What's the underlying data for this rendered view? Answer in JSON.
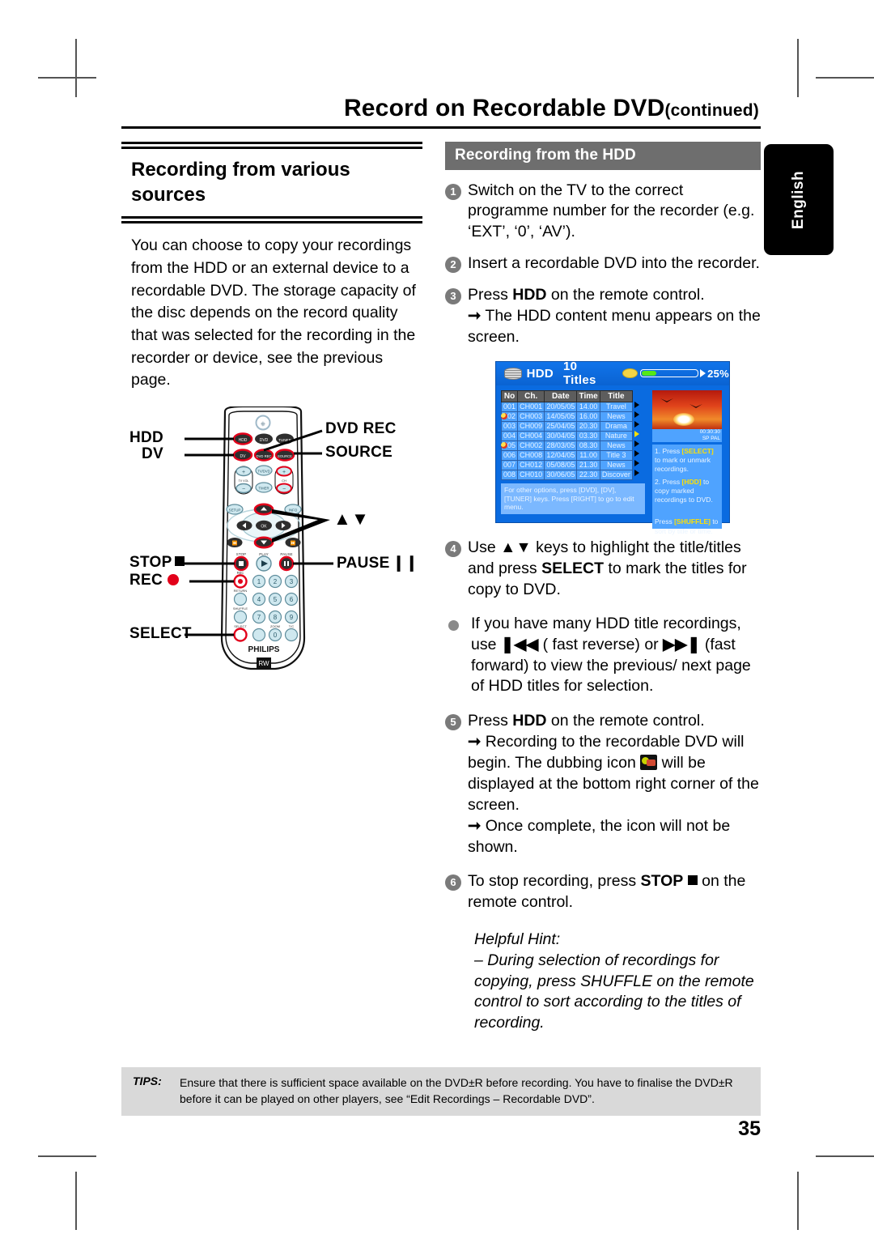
{
  "header": {
    "title": "Record on Recordable DVD",
    "continued": "(continued)"
  },
  "lang_tab": {
    "label": "English"
  },
  "left": {
    "heading": "Recording from various sources",
    "body": "You can choose to copy your recordings from the HDD or an external device to a recordable DVD. The storage capacity of the disc depends on the record quality that was selected for the recording in the recorder or device, see the previous page."
  },
  "remote": {
    "callouts": {
      "hdd": "HDD",
      "dv": "DV",
      "dvd_rec": "DVD REC",
      "source": "SOURCE",
      "updown": "▲▼",
      "stop": "STOP",
      "pause": "PAUSE",
      "rec": "REC",
      "select": "SELECT"
    },
    "brand": "PHILIPS",
    "buttons": {
      "hdd": "HDD",
      "dvd": "DVD",
      "tuner": "TUNER",
      "dv": "DV",
      "dvdrec": "DVD REC",
      "source": "SOURCE",
      "tvvol": "TV VOL",
      "tvdvd": "TV/DVD",
      "timer": "TIMER",
      "ch": "CH",
      "setup": "SETUP",
      "info": "INFO",
      "ok": "OK",
      "stop_lbl": "STOP",
      "play_lbl": "PLAY",
      "pause_lbl": "PAUSE",
      "rec_lbl": "REC",
      "return_lbl": "RETURN",
      "shuffle_lbl": "SHUFFLE",
      "select_lbl": "SELECT",
      "zoom_lbl": "ZOOM",
      "tc_lbl": "T/C",
      "digits": [
        "1",
        "2",
        "3",
        "4",
        "5",
        "6",
        "7",
        "8",
        "9",
        "0"
      ]
    }
  },
  "right": {
    "section_bar": "Recording from the HDD",
    "steps": [
      {
        "num": "1",
        "html": "Switch on the TV to the correct programme number for the recorder (e.g. ‘EXT’, ‘0’, ‘AV’)."
      },
      {
        "num": "2",
        "html": "Insert a recordable DVD into the recorder."
      },
      {
        "num": "3",
        "html": "Press HDD on the remote control."
      },
      {
        "num": "4",
        "html": "Use ▲▼ keys to highlight the title/titles and press SELECT to mark the titles for copy to DVD."
      },
      {
        "num": "5",
        "html": "Press HDD on the remote control."
      },
      {
        "num": "6",
        "html": "To stop recording, press STOP on the remote control."
      }
    ],
    "step3_arrow": "The HDD content menu appears on the screen.",
    "bullet_text": "If you have many HDD title recordings, use",
    "bullet_text2": "( fast reverse) or",
    "bullet_text3": "(fast forward) to view the previous/ next page of HDD titles for selection.",
    "step5_arrow1a": "Recording to the recordable DVD will begin. The dubbing icon",
    "step5_arrow1b": "will be displayed at the bottom right corner of the screen.",
    "step5_arrow2": "Once complete, the icon will not be shown.",
    "helpful_hint_label": "Helpful Hint:",
    "helpful_hint_body": "– During selection of recordings for copying, press SHUFFLE on the remote control to sort according to the titles of recording."
  },
  "tv_screen": {
    "title": "HDD",
    "titles_count": "10 Titles",
    "percent": "25%",
    "columns": [
      "No",
      "Ch.",
      "Date",
      "Time",
      "Title"
    ],
    "rows": [
      {
        "no": "001",
        "ch": "CH001",
        "date": "20/05/05",
        "time": "14.00",
        "title": "Travel",
        "marked": false,
        "selected": false
      },
      {
        "no": "002",
        "ch": "CH003",
        "date": "14/05/05",
        "time": "16.00",
        "title": "News",
        "marked": true,
        "selected": false
      },
      {
        "no": "003",
        "ch": "CH009",
        "date": "25/04/05",
        "time": "20.30",
        "title": "Drama",
        "marked": false,
        "selected": false
      },
      {
        "no": "004",
        "ch": "CH004",
        "date": "30/04/05",
        "time": "03.30",
        "title": "Nature",
        "marked": false,
        "selected": true
      },
      {
        "no": "005",
        "ch": "CH002",
        "date": "28/03/05",
        "time": "08.30",
        "title": "News",
        "marked": true,
        "selected": false
      },
      {
        "no": "006",
        "ch": "CH008",
        "date": "12/04/05",
        "time": "11.00",
        "title": "Title 3",
        "marked": false,
        "selected": false
      },
      {
        "no": "007",
        "ch": "CH012",
        "date": "05/08/05",
        "time": "21.30",
        "title": "News",
        "marked": false,
        "selected": false
      },
      {
        "no": "008",
        "ch": "CH010",
        "date": "30/06/05",
        "time": "22.30",
        "title": "Discover",
        "marked": false,
        "selected": false
      }
    ],
    "bottom_hint": "For other options, press [DVD], [DV], [TUNER] keys. Press [RIGHT] to go to edit menu.",
    "thumb_time": "00:30:30",
    "thumb_mode": "SP  PAL",
    "side_step1_pre": "1. Press ",
    "side_step1_key": "[SELECT]",
    "side_step1_post": " to mark or unmark recordings.",
    "side_step2_pre": "2. Press ",
    "side_step2_key": "[HDD]",
    "side_step2_post": " to copy marked recordings to DVD.",
    "side_step3_pre": "Press ",
    "side_step3_key": "[SHUFFLE]",
    "side_step3_post": " to sort by title or time."
  },
  "tips": {
    "label": "TIPS:",
    "text": "Ensure that there is sufficient space available on the DVD±R before recording. You have to finalise the DVD±R before it can be played on other players, see “Edit Recordings – Recordable DVD”."
  },
  "page_number": "35",
  "colors": {
    "section_bar": "#6e6e6e",
    "tips_bg": "#d9d9d9",
    "tv_blue": "#0a6be0",
    "tv_row_blue": "#4fa3ff",
    "key_yellow": "#ffe000",
    "progress_green": "#55e817",
    "remote_red": "#e2001a"
  }
}
